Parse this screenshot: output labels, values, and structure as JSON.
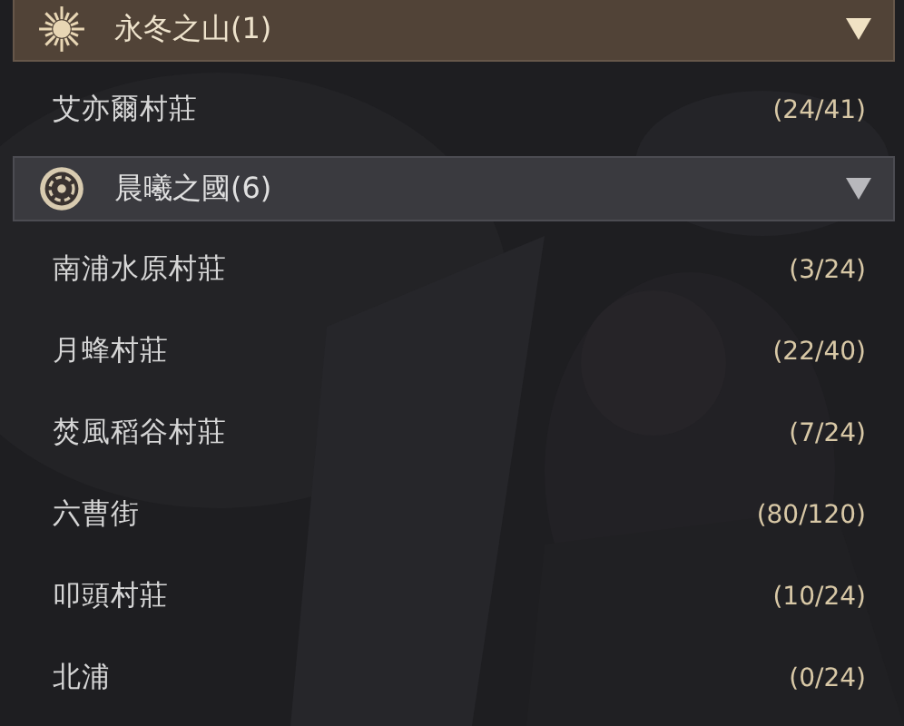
{
  "regions": [
    {
      "name": "永冬之山(1)",
      "kind": "sun",
      "selected": true,
      "expanded": true,
      "villages": [
        {
          "name": "艾亦爾村莊",
          "count": "(24/41)"
        }
      ]
    },
    {
      "name": "晨曦之國(6)",
      "kind": "emblem",
      "selected": false,
      "expanded": true,
      "villages": [
        {
          "name": "南浦水原村莊",
          "count": "(3/24)"
        },
        {
          "name": "月蜂村莊",
          "count": "(22/40)"
        },
        {
          "name": "焚風稻谷村莊",
          "count": "(7/24)"
        },
        {
          "name": "六曹街",
          "count": "(80/120)"
        },
        {
          "name": "叩頭村莊",
          "count": "(10/24)"
        },
        {
          "name": "北浦",
          "count": "(0/24)"
        }
      ]
    }
  ]
}
